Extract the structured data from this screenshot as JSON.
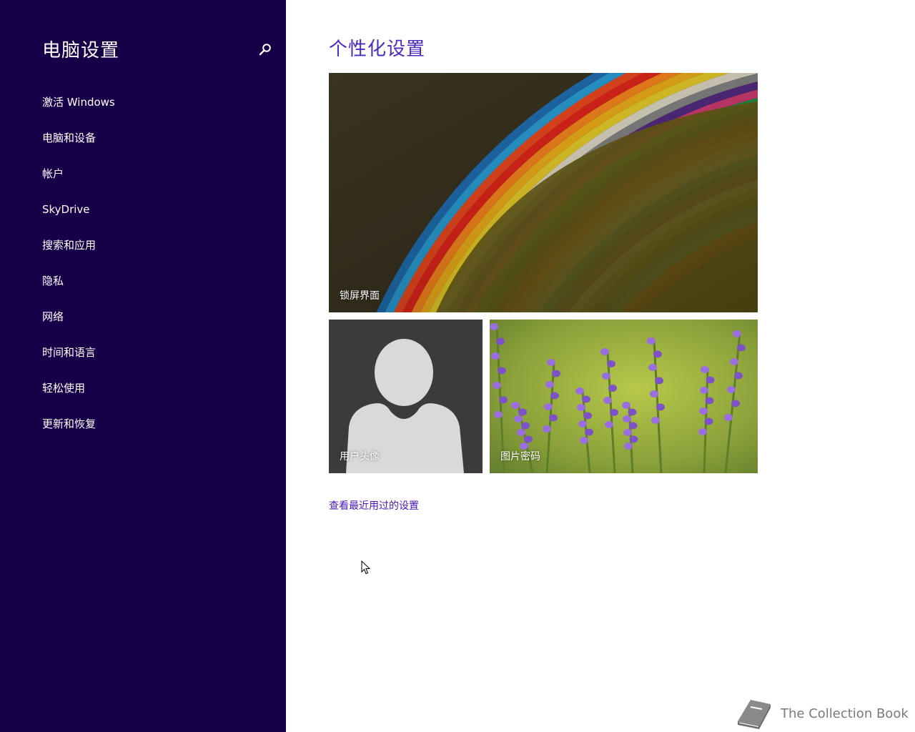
{
  "sidebar": {
    "title": "电脑设置",
    "search_icon": "search-icon",
    "background_color": "#180048",
    "items": [
      {
        "label": "激活 Windows"
      },
      {
        "label": "电脑和设备"
      },
      {
        "label": "帐户"
      },
      {
        "label": "SkyDrive"
      },
      {
        "label": "搜索和应用"
      },
      {
        "label": "隐私"
      },
      {
        "label": "网络"
      },
      {
        "label": "时间和语言"
      },
      {
        "label": "轻松使用"
      },
      {
        "label": "更新和恢复"
      }
    ]
  },
  "main": {
    "title": "个性化设置",
    "accent_color": "#4a2abf",
    "tiles": {
      "lock_screen": {
        "label": "锁屏界面",
        "image": "colorful-paper-strips"
      },
      "avatar": {
        "label": "用户头像",
        "image": "default-user-silhouette"
      },
      "picture_password": {
        "label": "图片密码",
        "image": "lavander-flowers"
      }
    },
    "recent_link": "查看最近用过的设置"
  },
  "watermark": {
    "text": "The Collection Book",
    "icon": "book-icon"
  }
}
